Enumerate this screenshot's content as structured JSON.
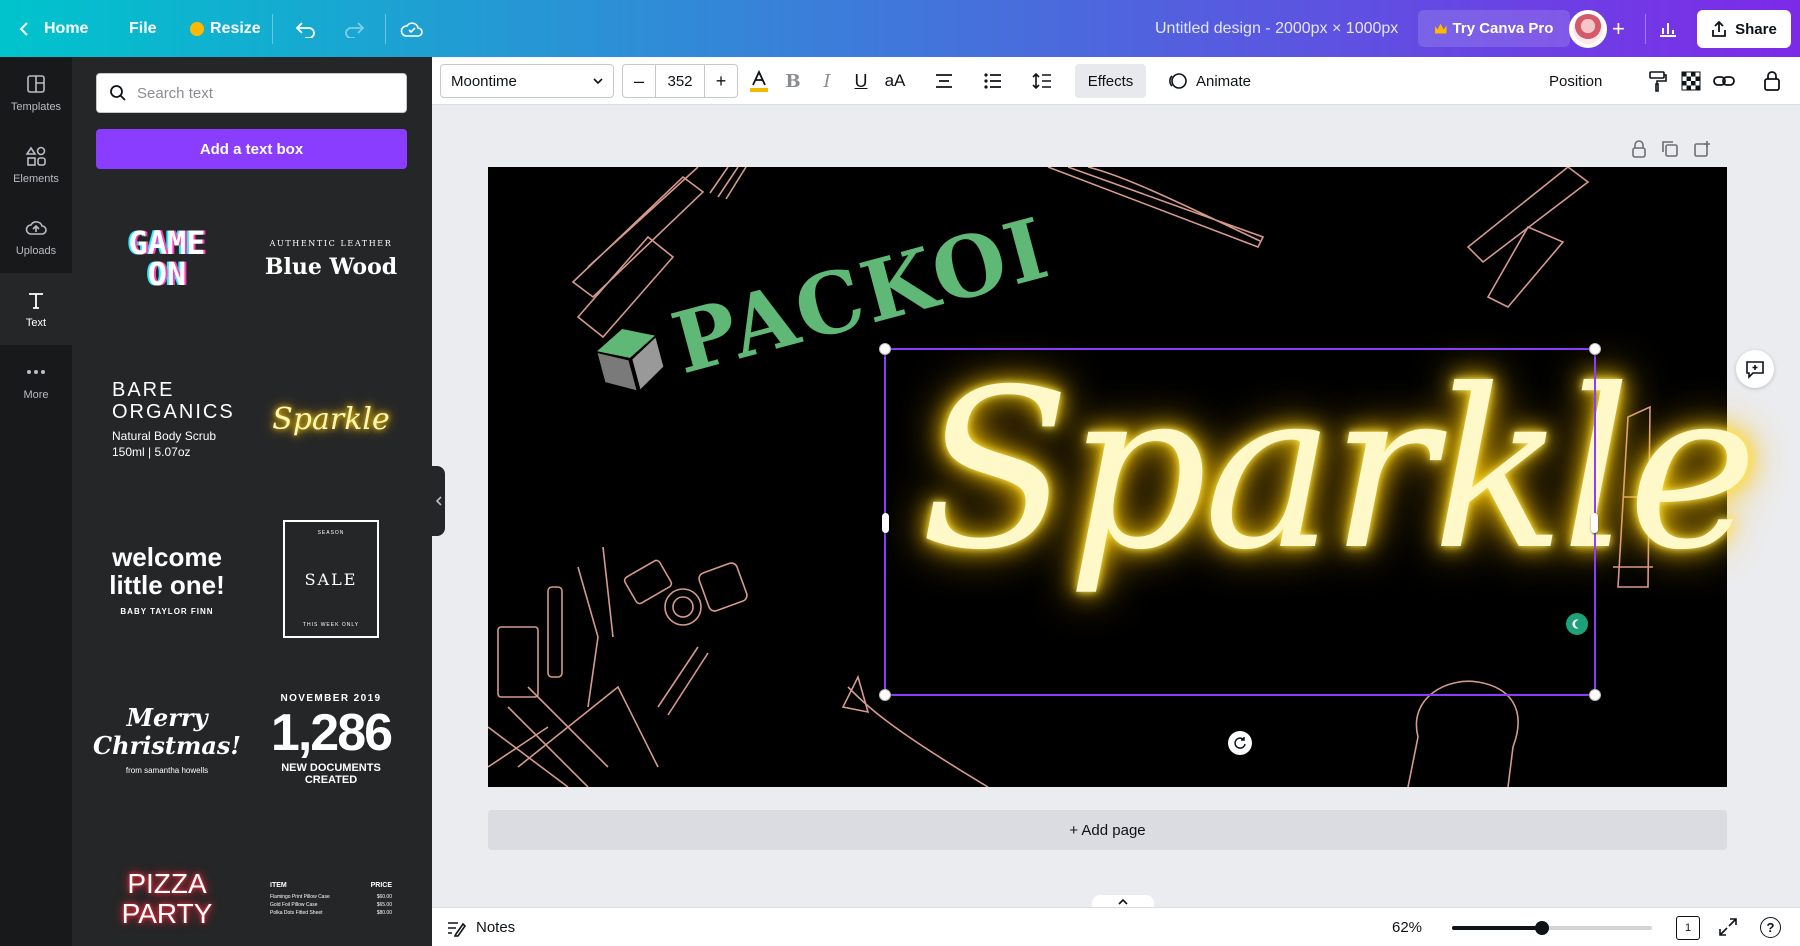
{
  "topbar": {
    "home_label": "Home",
    "file_label": "File",
    "resize_label": "Resize",
    "doc_title": "Untitled design - 2000px × 1000px",
    "try_pro_label": "Try Canva Pro",
    "share_label": "Share"
  },
  "rail": {
    "items": [
      {
        "label": "Templates",
        "icon": "templates-icon"
      },
      {
        "label": "Elements",
        "icon": "elements-icon"
      },
      {
        "label": "Uploads",
        "icon": "uploads-icon"
      },
      {
        "label": "Text",
        "icon": "text-icon"
      },
      {
        "label": "More",
        "icon": "more-icon"
      }
    ]
  },
  "panel": {
    "search_placeholder": "Search text",
    "add_text_label": "Add a text box",
    "tiles": {
      "game_on": {
        "line1": "GAME",
        "line2": "ON"
      },
      "blue_wood": {
        "kicker": "AUTHENTIC LEATHER",
        "title": "Blue Wood"
      },
      "bare_organics": {
        "title1": "BARE",
        "title2": "ORGANICS",
        "sub1": "Natural Body Scrub",
        "sub2": "150ml | 5.07oz"
      },
      "sparkle_tile": {
        "text": "Sparkle"
      },
      "welcome": {
        "line1": "welcome",
        "line2": "little one!",
        "sub": "BABY TAYLOR FINN"
      },
      "sale": {
        "top": "SEASON",
        "title": "SALE",
        "bottom": "THIS WEEK ONLY"
      },
      "merry": {
        "line1": "Merry",
        "line2": "Christmas!",
        "sub": "from samantha howells"
      },
      "stats": {
        "kicker": "NOVEMBER 2019",
        "number": "1,286",
        "sub1": "NEW DOCUMENTS",
        "sub2": "CREATED"
      },
      "pizza": {
        "line1": "PIZZA",
        "line2": "PARTY"
      },
      "price_list": {
        "col1": "ITEM",
        "col2": "PRICE",
        "rows": [
          {
            "item": "Flamingo Print Pillow Case",
            "price": "$60.00"
          },
          {
            "item": "Gold Foil Pillow Case",
            "price": "$65.00"
          },
          {
            "item": "Polka Dots Fitted Sheet",
            "price": "$80.00"
          }
        ]
      }
    }
  },
  "toolbar": {
    "font_name": "Moontime",
    "font_size": "352",
    "minus_label": "–",
    "plus_label": "+",
    "effects_label": "Effects",
    "animate_label": "Animate",
    "position_label": "Position"
  },
  "canvas": {
    "logo_text": "PACKOI",
    "sparkle_text": "Sparkle",
    "add_page_label": "+ Add page",
    "colors": {
      "neon": "#ffe75a",
      "logo_green": "#5fb875",
      "logo_gray": "#7a7a7a",
      "line_art": "#d59a8c",
      "selection": "#8b3dff"
    }
  },
  "bottombar": {
    "notes_label": "Notes",
    "zoom_value": "62%",
    "zoom_fraction": 0.45,
    "page_count": "1"
  },
  "colors": {
    "accent": "#8b3dff",
    "topbar_start": "#00c4cc",
    "topbar_end": "#7d2ae8"
  }
}
